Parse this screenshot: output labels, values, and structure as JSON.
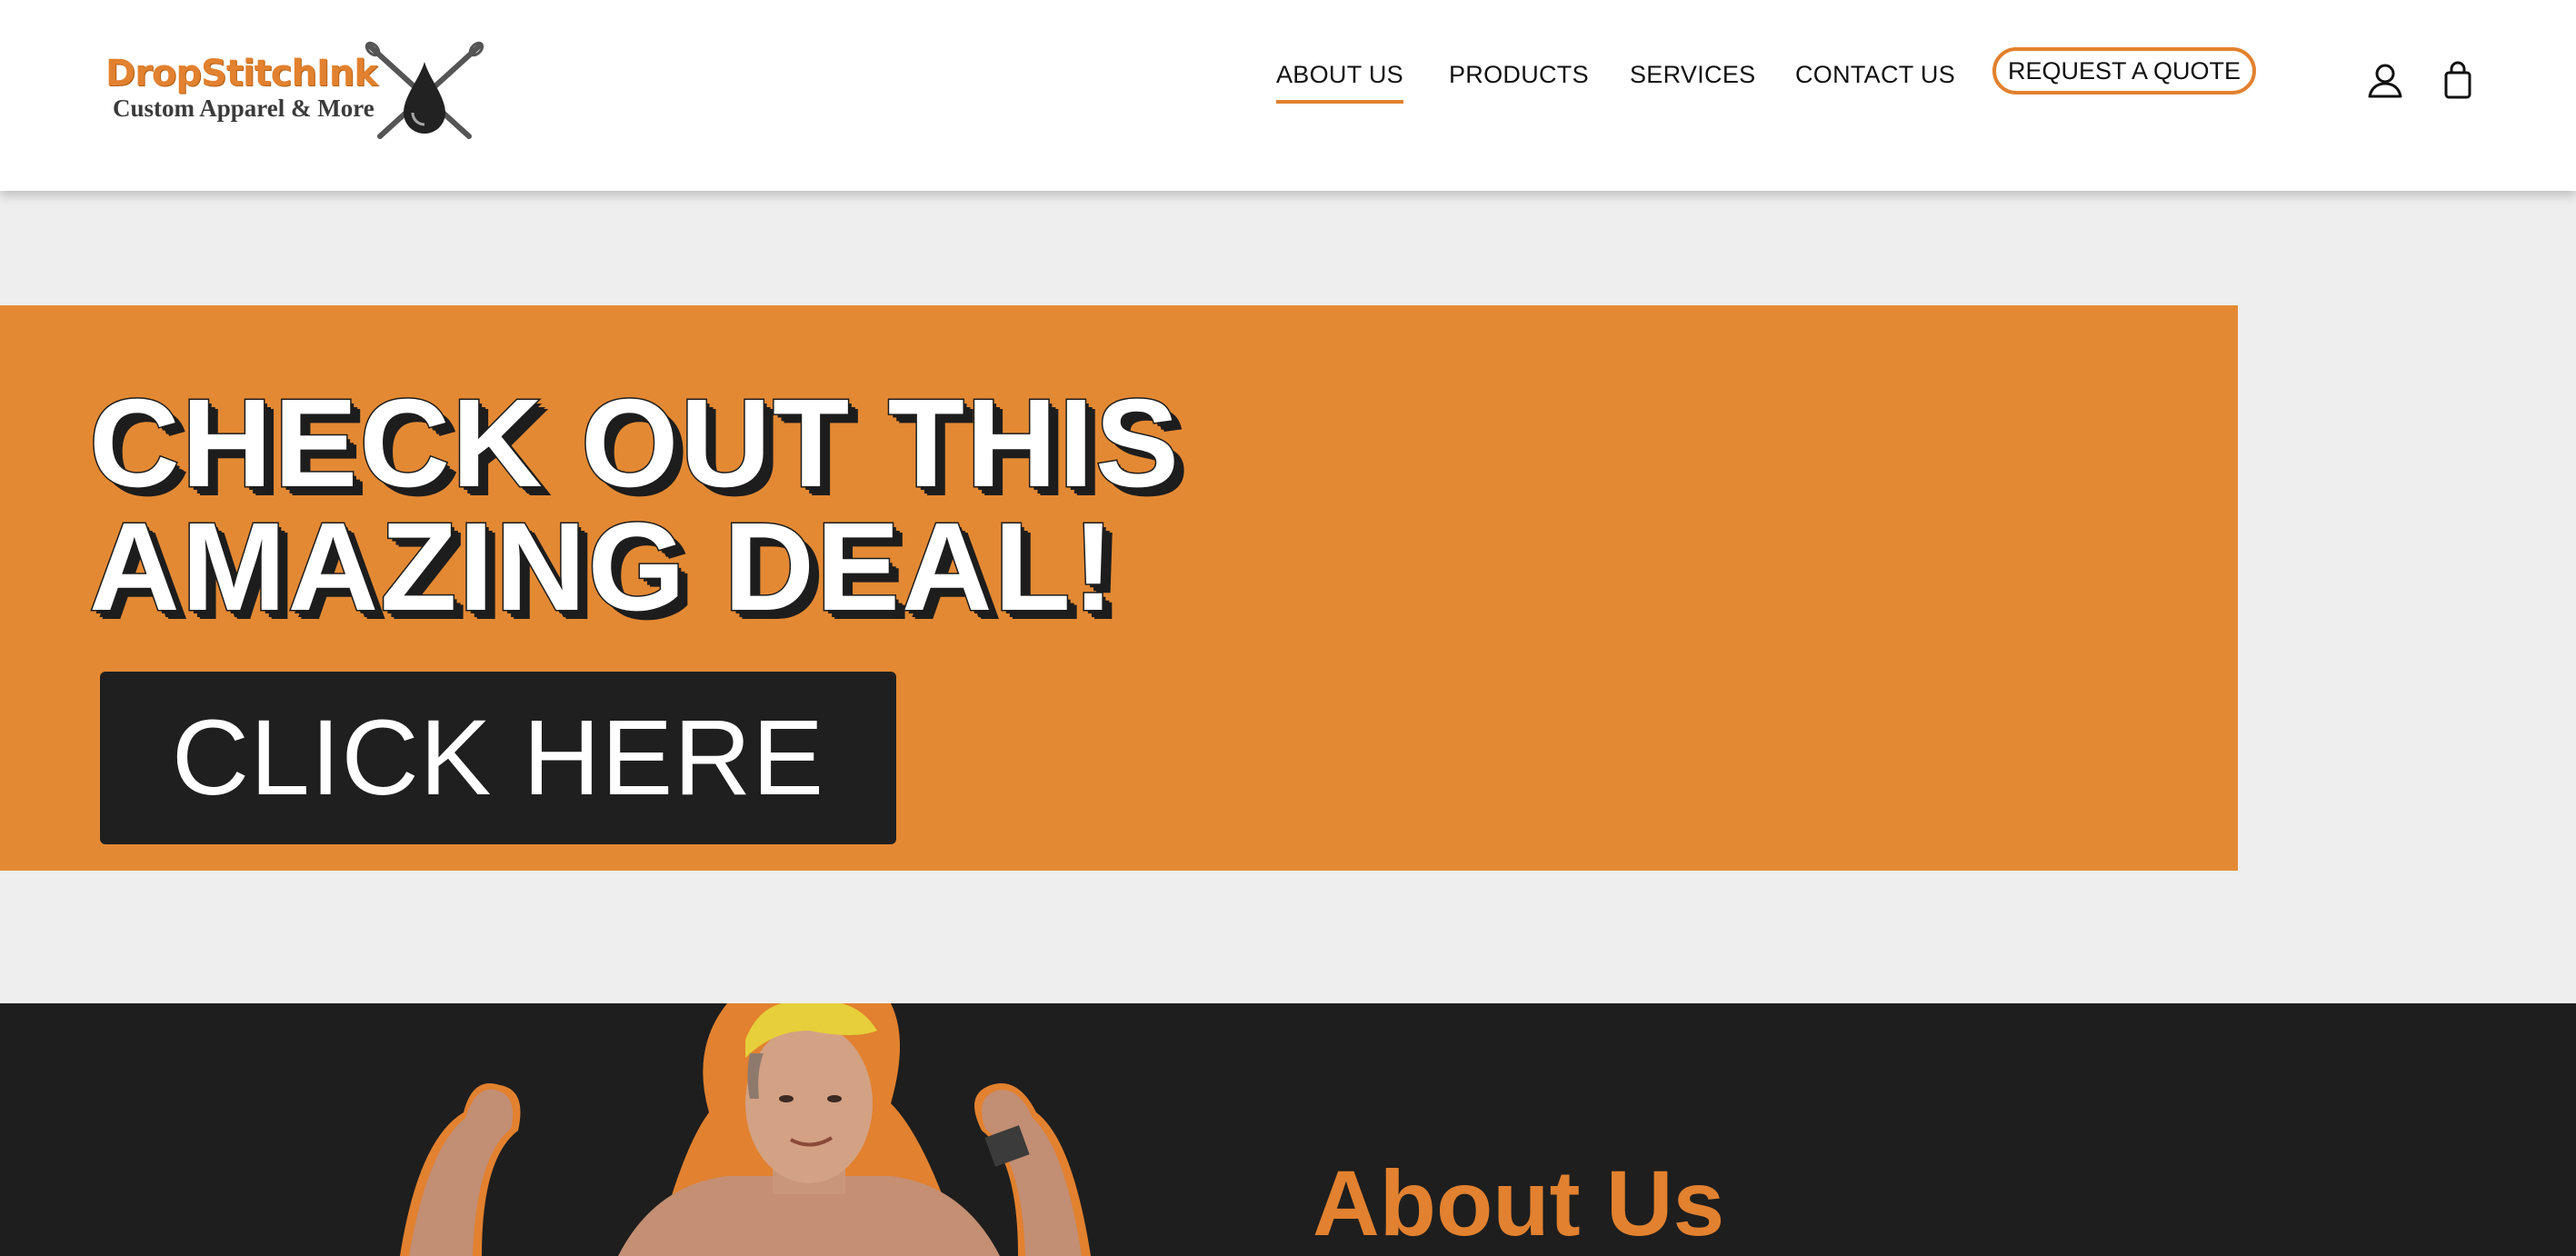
{
  "brand": {
    "name": "DropStitchInk",
    "tagline": "Custom Apparel & More",
    "accent_color": "#e2812f",
    "dark_color": "#1f1f1f"
  },
  "nav": {
    "items": [
      {
        "label": "ABOUT US",
        "active": true
      },
      {
        "label": "PRODUCTS",
        "active": false
      },
      {
        "label": "SERVICES",
        "active": false
      },
      {
        "label": "CONTACT US",
        "active": false
      }
    ],
    "cta_label": "REQUEST A QUOTE",
    "icons": [
      "account-icon",
      "shopping-bag-icon"
    ]
  },
  "promo": {
    "title_line1": "CHECK OUT THIS",
    "title_line2": "AMAZING DEAL!",
    "button_label": "CLICK HERE",
    "background_color": "#e48933"
  },
  "about": {
    "heading": "About Us",
    "background_color": "#1e1e1e"
  }
}
